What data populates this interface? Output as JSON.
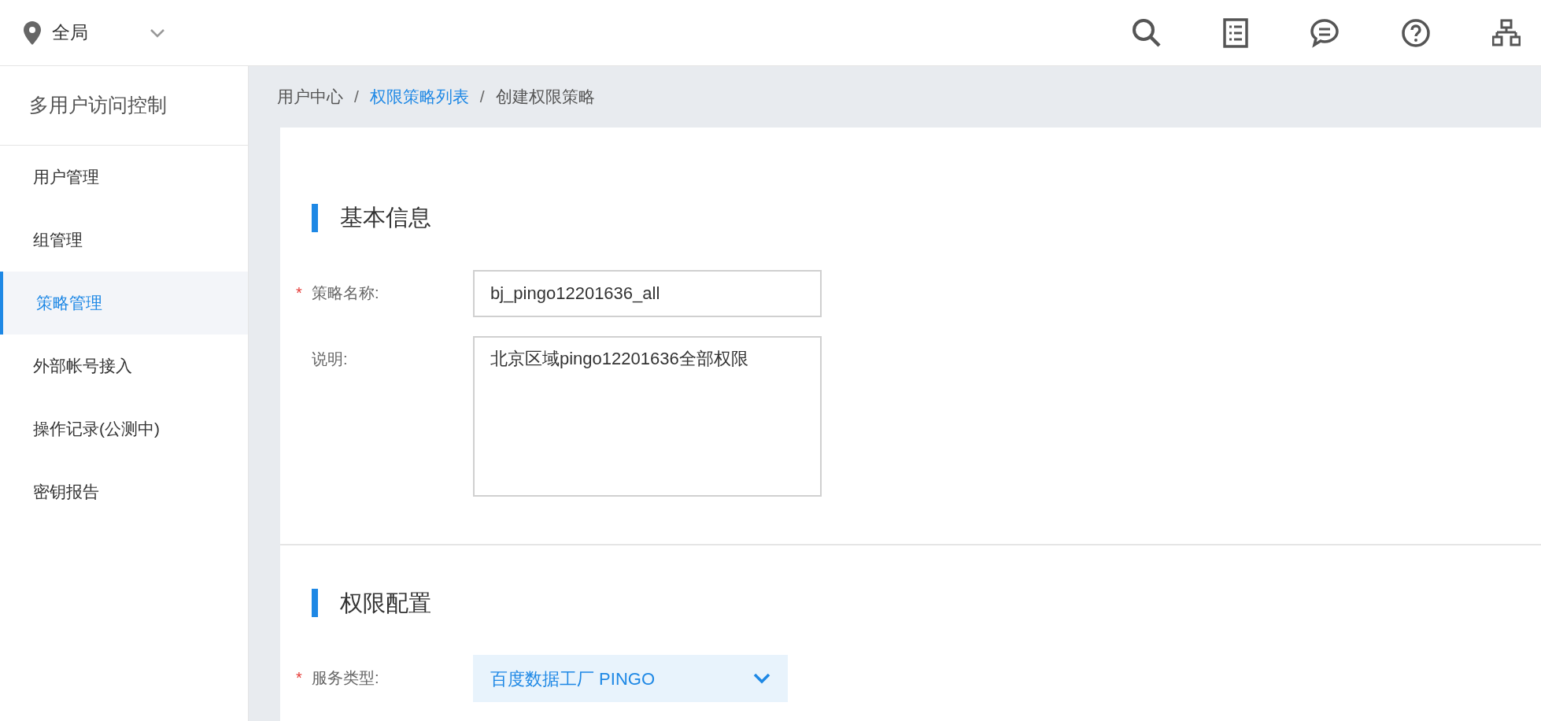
{
  "topbar": {
    "region": "全局"
  },
  "sidebar": {
    "title": "多用户访问控制",
    "items": [
      {
        "label": "用户管理",
        "selected": false
      },
      {
        "label": "组管理",
        "selected": false
      },
      {
        "label": "策略管理",
        "selected": true
      },
      {
        "label": "外部帐号接入",
        "selected": false
      },
      {
        "label": "操作记录(公测中)",
        "selected": false
      },
      {
        "label": "密钥报告",
        "selected": false
      }
    ]
  },
  "breadcrumb": [
    {
      "label": "用户中心",
      "kind": "text"
    },
    {
      "label": "/",
      "kind": "separator"
    },
    {
      "label": "权限策略列表",
      "kind": "link"
    },
    {
      "label": "/",
      "kind": "separator"
    },
    {
      "label": "创建权限策略",
      "kind": "text"
    }
  ],
  "sections": [
    {
      "title": "基本信息",
      "fields": [
        {
          "kind": "input",
          "required_mark": "*",
          "label": "策略名称:",
          "value": "bj_pingo12201636_all"
        },
        {
          "kind": "textarea",
          "label": "说明:",
          "value": "北京区域pingo12201636全部权限"
        }
      ]
    },
    {
      "title": "权限配置",
      "fields": [
        {
          "kind": "select",
          "required_mark": "*",
          "label": "服务类型:",
          "value": "百度数据工厂 PINGO"
        }
      ]
    }
  ]
}
